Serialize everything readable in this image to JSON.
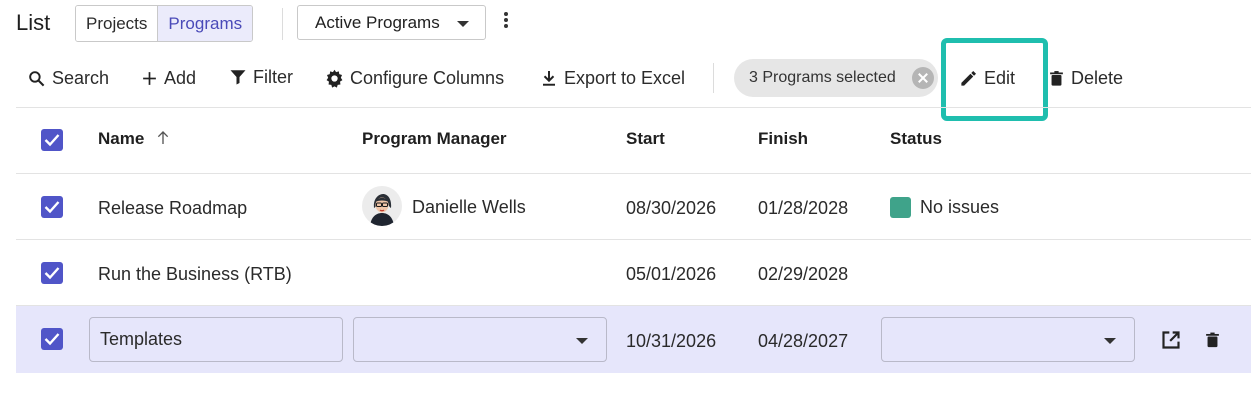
{
  "header": {
    "title": "List",
    "segments": [
      "Projects",
      "Programs"
    ],
    "active_segment": "Programs",
    "view": "Active Programs"
  },
  "toolbar": {
    "search": "Search",
    "add": "Add",
    "filter": "Filter",
    "configure": "Configure Columns",
    "export": "Export to Excel",
    "selection": "3 Programs selected",
    "edit": "Edit",
    "delete": "Delete"
  },
  "columns": {
    "name": "Name",
    "manager": "Program Manager",
    "start": "Start",
    "finish": "Finish",
    "status": "Status"
  },
  "rows": [
    {
      "name": "Release Roadmap",
      "manager": "Danielle Wells",
      "start": "08/30/2026",
      "finish": "01/28/2028",
      "status": "No issues",
      "checked": true
    },
    {
      "name": "Run the Business (RTB)",
      "manager": "",
      "start": "05/01/2026",
      "finish": "02/29/2028",
      "status": "",
      "checked": true
    },
    {
      "name": "Templates",
      "manager": "",
      "start": "10/31/2026",
      "finish": "04/28/2027",
      "status": "",
      "checked": true,
      "editing": true
    }
  ],
  "colors": {
    "accent": "#5055c8",
    "selected_row": "#e6e6fb",
    "highlight": "#1fbeae",
    "status_ok": "#3fa38a"
  },
  "icons": {
    "search": "search-icon",
    "add": "plus-icon",
    "filter": "filter-icon",
    "configure": "gear-icon",
    "export": "download-icon",
    "edit": "pencil-icon",
    "delete": "trash-icon",
    "sort": "arrow-up-icon",
    "open": "external-link-icon"
  }
}
